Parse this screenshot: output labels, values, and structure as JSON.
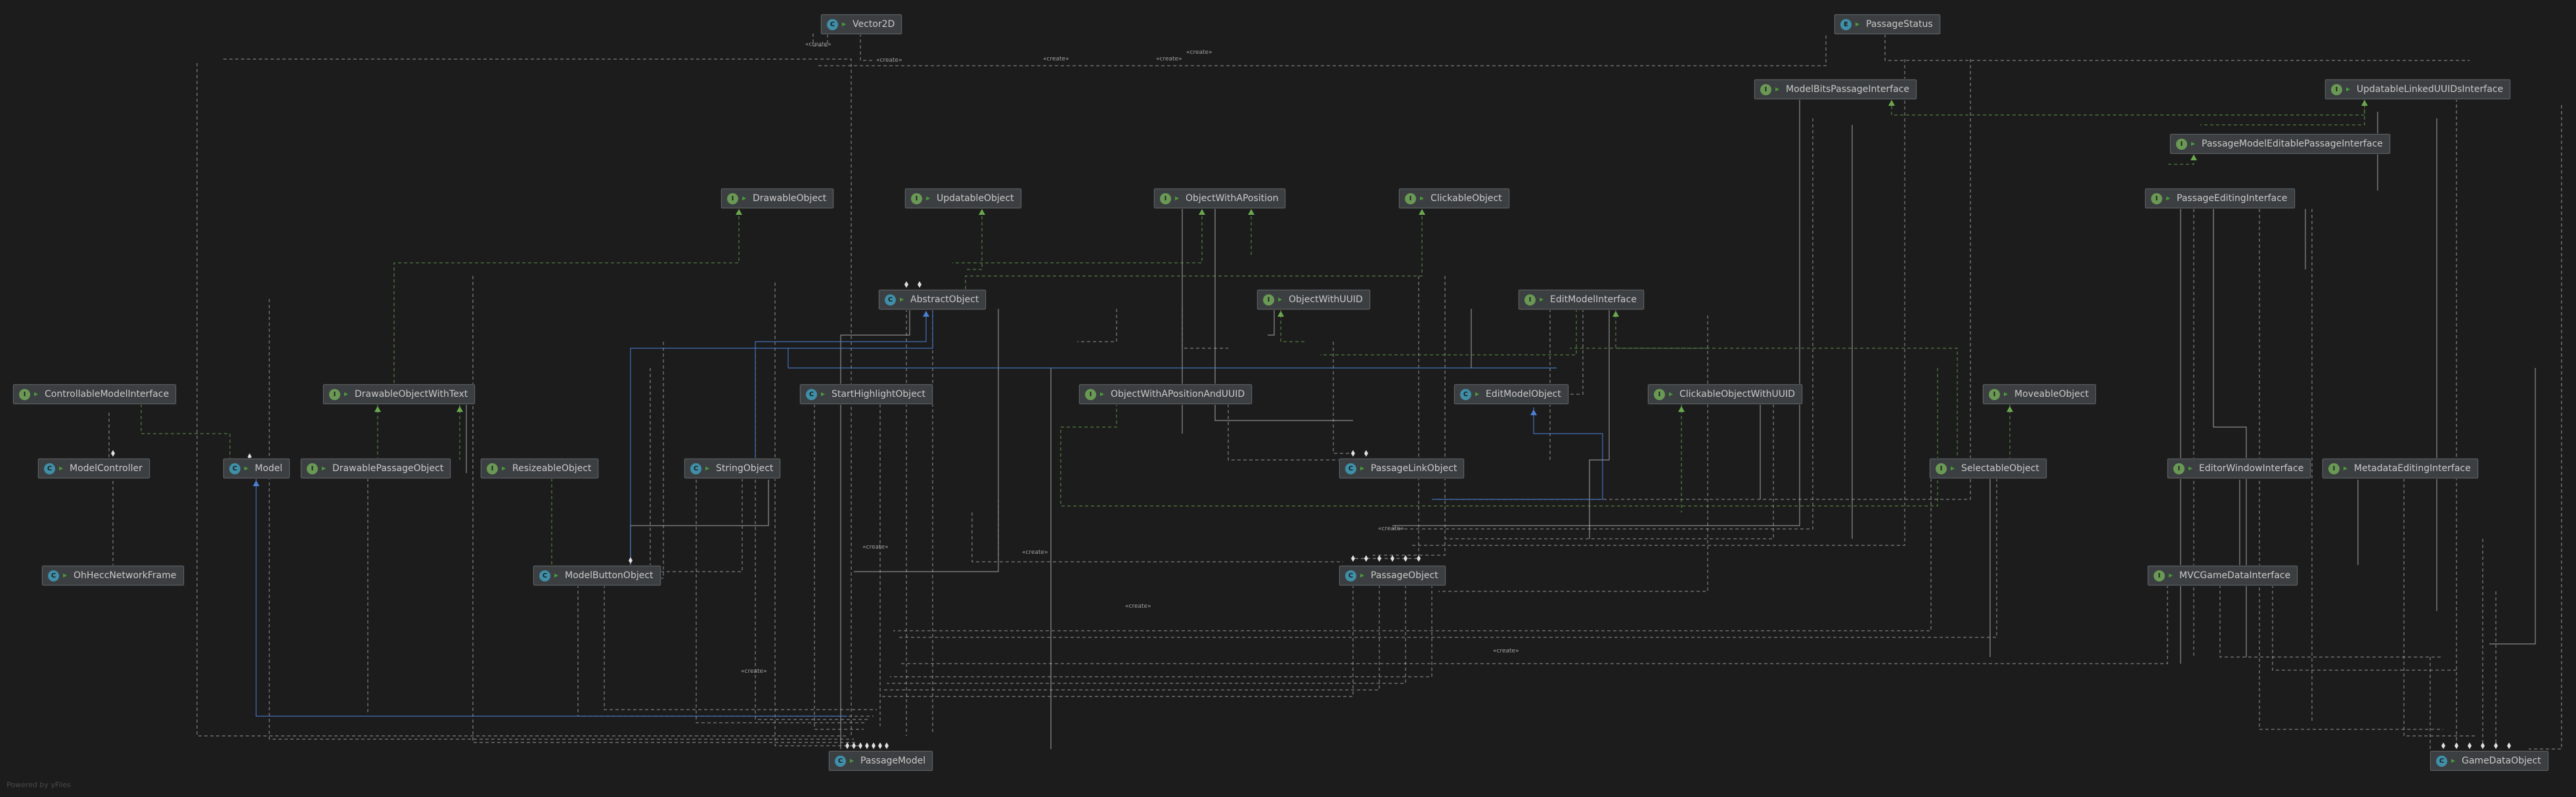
{
  "watermark": "Powered by yFiles",
  "edge_label": "«create»",
  "colors": {
    "background": "#1c1c1d",
    "node_fill": "#3c3f41",
    "node_border": "#5c6063",
    "interface_badge": "#6a9955",
    "class_badge": "#3f8fa8",
    "dependency_line": "#bdbdbd",
    "realization_line": "#6aa84f",
    "generalization_line": "#4a7fd1"
  },
  "nodes": [
    {
      "id": "Vector2D",
      "label": "Vector2D",
      "kind": "class"
    },
    {
      "id": "PassageStatus",
      "label": "PassageStatus",
      "kind": "enum"
    },
    {
      "id": "ModelBitsPassageInterface",
      "label": "ModelBitsPassageInterface",
      "kind": "interface"
    },
    {
      "id": "UpdatableLinkedUUIDsInterface",
      "label": "UpdatableLinkedUUIDsInterface",
      "kind": "interface"
    },
    {
      "id": "PassageModelEditablePassageInterface",
      "label": "PassageModelEditablePassageInterface",
      "kind": "interface"
    },
    {
      "id": "PassageEditingInterface",
      "label": "PassageEditingInterface",
      "kind": "interface"
    },
    {
      "id": "DrawableObject",
      "label": "DrawableObject",
      "kind": "interface"
    },
    {
      "id": "UpdatableObject",
      "label": "UpdatableObject",
      "kind": "interface"
    },
    {
      "id": "ObjectWithAPosition",
      "label": "ObjectWithAPosition",
      "kind": "interface"
    },
    {
      "id": "ClickableObject",
      "label": "ClickableObject",
      "kind": "interface"
    },
    {
      "id": "AbstractObject",
      "label": "AbstractObject",
      "kind": "class"
    },
    {
      "id": "ObjectWithUUID",
      "label": "ObjectWithUUID",
      "kind": "interface"
    },
    {
      "id": "EditModelInterface",
      "label": "EditModelInterface",
      "kind": "interface"
    },
    {
      "id": "ControllableModelInterface",
      "label": "ControllableModelInterface",
      "kind": "interface"
    },
    {
      "id": "DrawableObjectWithText",
      "label": "DrawableObjectWithText",
      "kind": "interface"
    },
    {
      "id": "StartHighlightObject",
      "label": "StartHighlightObject",
      "kind": "class"
    },
    {
      "id": "ObjectWithAPositionAndUUID",
      "label": "ObjectWithAPositionAndUUID",
      "kind": "interface"
    },
    {
      "id": "EditModelObject",
      "label": "EditModelObject",
      "kind": "class"
    },
    {
      "id": "ClickableObjectWithUUID",
      "label": "ClickableObjectWithUUID",
      "kind": "interface"
    },
    {
      "id": "MoveableObject",
      "label": "MoveableObject",
      "kind": "interface"
    },
    {
      "id": "ModelController",
      "label": "ModelController",
      "kind": "class"
    },
    {
      "id": "Model",
      "label": "Model",
      "kind": "class"
    },
    {
      "id": "DrawablePassageObject",
      "label": "DrawablePassageObject",
      "kind": "interface"
    },
    {
      "id": "ResizeableObject",
      "label": "ResizeableObject",
      "kind": "interface"
    },
    {
      "id": "StringObject",
      "label": "StringObject",
      "kind": "class"
    },
    {
      "id": "PassageLinkObject",
      "label": "PassageLinkObject",
      "kind": "class"
    },
    {
      "id": "SelectableObject",
      "label": "SelectableObject",
      "kind": "interface"
    },
    {
      "id": "EditorWindowInterface",
      "label": "EditorWindowInterface",
      "kind": "interface"
    },
    {
      "id": "MetadataEditingInterface",
      "label": "MetadataEditingInterface",
      "kind": "interface"
    },
    {
      "id": "OhHeccNetworkFrame",
      "label": "OhHeccNetworkFrame",
      "kind": "class"
    },
    {
      "id": "ModelButtonObject",
      "label": "ModelButtonObject",
      "kind": "class"
    },
    {
      "id": "PassageObject",
      "label": "PassageObject",
      "kind": "class"
    },
    {
      "id": "MVCGameDataInterface",
      "label": "MVCGameDataInterface",
      "kind": "interface"
    },
    {
      "id": "PassageModel",
      "label": "PassageModel",
      "kind": "class"
    },
    {
      "id": "GameDataObject",
      "label": "GameDataObject",
      "kind": "class"
    }
  ]
}
